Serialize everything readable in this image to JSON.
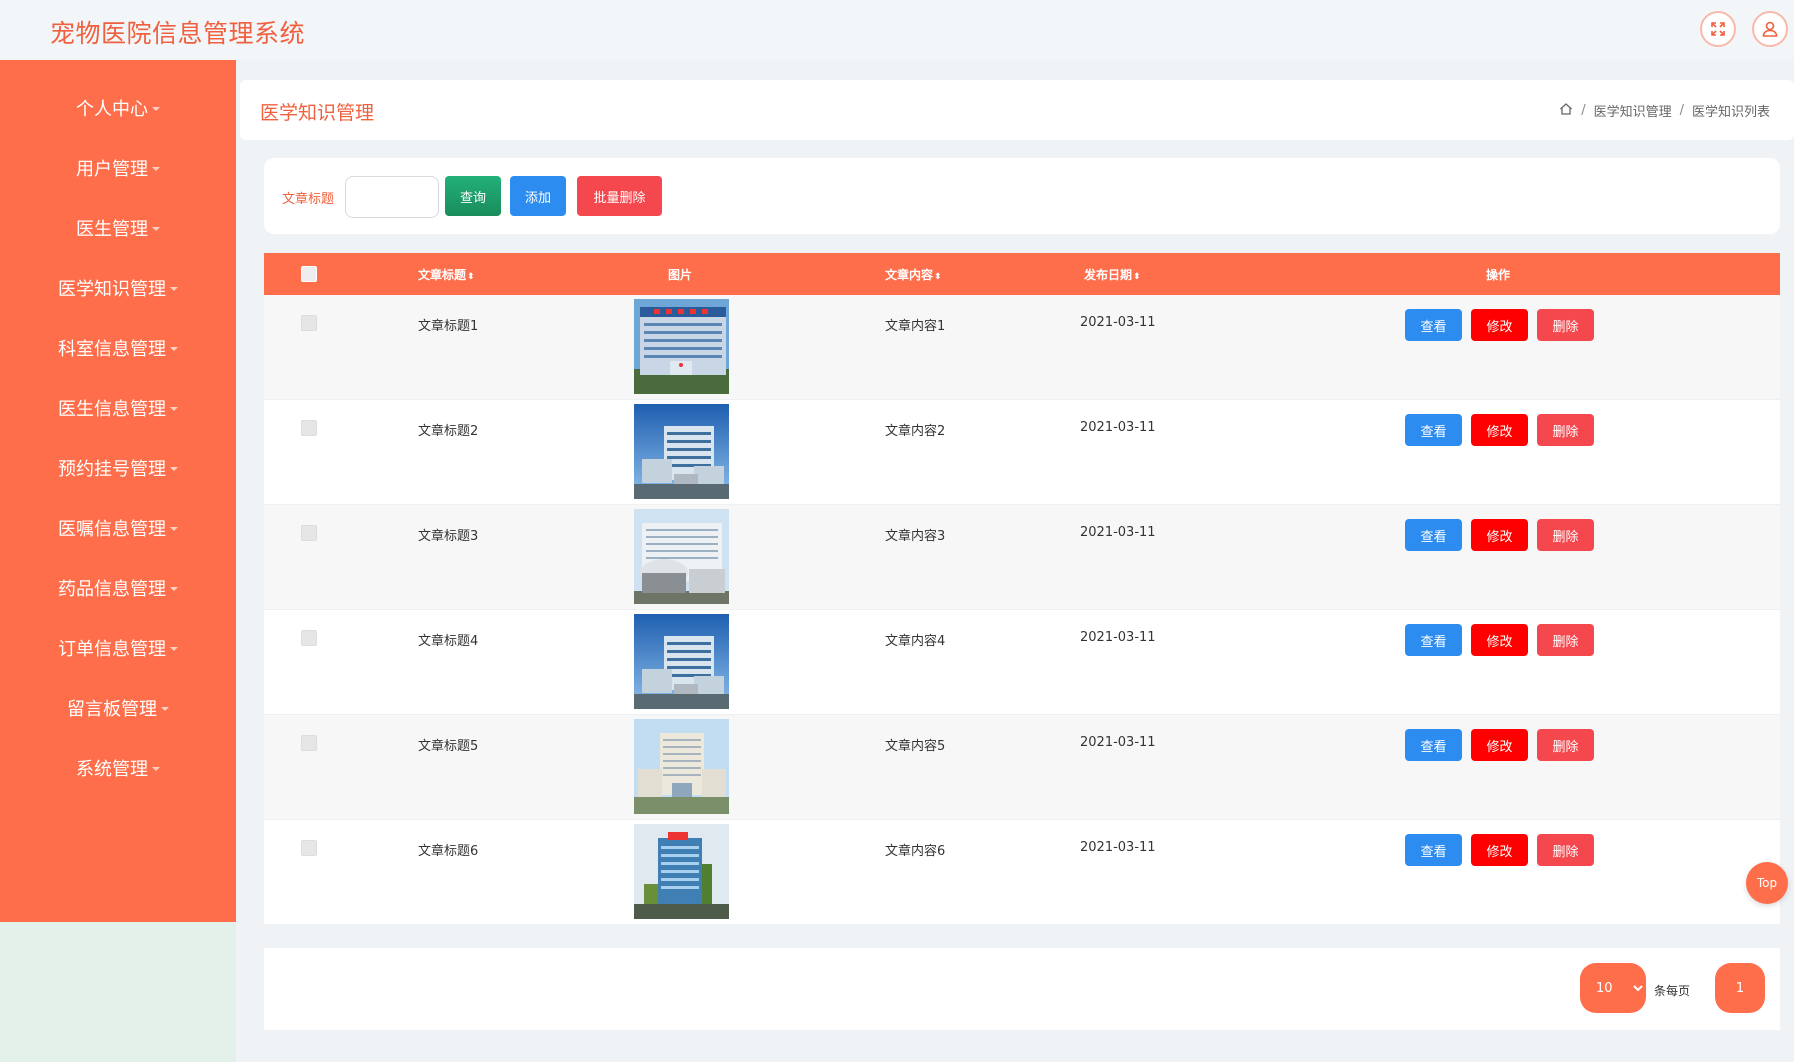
{
  "app": {
    "title": "宠物医院信息管理系统"
  },
  "top_icons": [
    "fullscreen-icon",
    "user-icon"
  ],
  "sidebar": {
    "items": [
      {
        "label": "个人中心"
      },
      {
        "label": "用户管理"
      },
      {
        "label": "医生管理"
      },
      {
        "label": "医学知识管理"
      },
      {
        "label": "科室信息管理"
      },
      {
        "label": "医生信息管理"
      },
      {
        "label": "预约挂号管理"
      },
      {
        "label": "医嘱信息管理"
      },
      {
        "label": "药品信息管理"
      },
      {
        "label": "订单信息管理"
      },
      {
        "label": "留言板管理"
      },
      {
        "label": "系统管理"
      }
    ]
  },
  "header": {
    "title": "医学知识管理",
    "breadcrumb": [
      "医学知识管理",
      "医学知识列表"
    ],
    "separator": "/"
  },
  "search": {
    "label": "文章标题",
    "value": "",
    "query_button": "查询",
    "add_button": "添加",
    "batch_delete_button": "批量删除"
  },
  "table": {
    "columns": {
      "title": "文章标题",
      "image": "图片",
      "content": "文章内容",
      "date": "发布日期",
      "actions": "操作"
    },
    "rows": [
      {
        "title": "文章标题1",
        "content": "文章内容1",
        "date": "2021-03-11"
      },
      {
        "title": "文章标题2",
        "content": "文章内容2",
        "date": "2021-03-11"
      },
      {
        "title": "文章标题3",
        "content": "文章内容3",
        "date": "2021-03-11"
      },
      {
        "title": "文章标题4",
        "content": "文章内容4",
        "date": "2021-03-11"
      },
      {
        "title": "文章标题5",
        "content": "文章内容5",
        "date": "2021-03-11"
      },
      {
        "title": "文章标题6",
        "content": "文章内容6",
        "date": "2021-03-11"
      }
    ],
    "actions": {
      "view": "查看",
      "edit": "修改",
      "delete": "删除"
    }
  },
  "pagination": {
    "page_size": "10",
    "page_size_label": "条每页",
    "current_page": "1"
  },
  "back_to_top": "Top",
  "colors": {
    "primary": "#ff6e4b",
    "title_text": "#f0603f",
    "query_button": "#1f9d68",
    "add_button": "#2d8cf0",
    "batch_delete_button": "#f5484e",
    "view_button": "#2d8cf0",
    "edit_button": "#ff0000",
    "delete_button": "#f5484e"
  }
}
